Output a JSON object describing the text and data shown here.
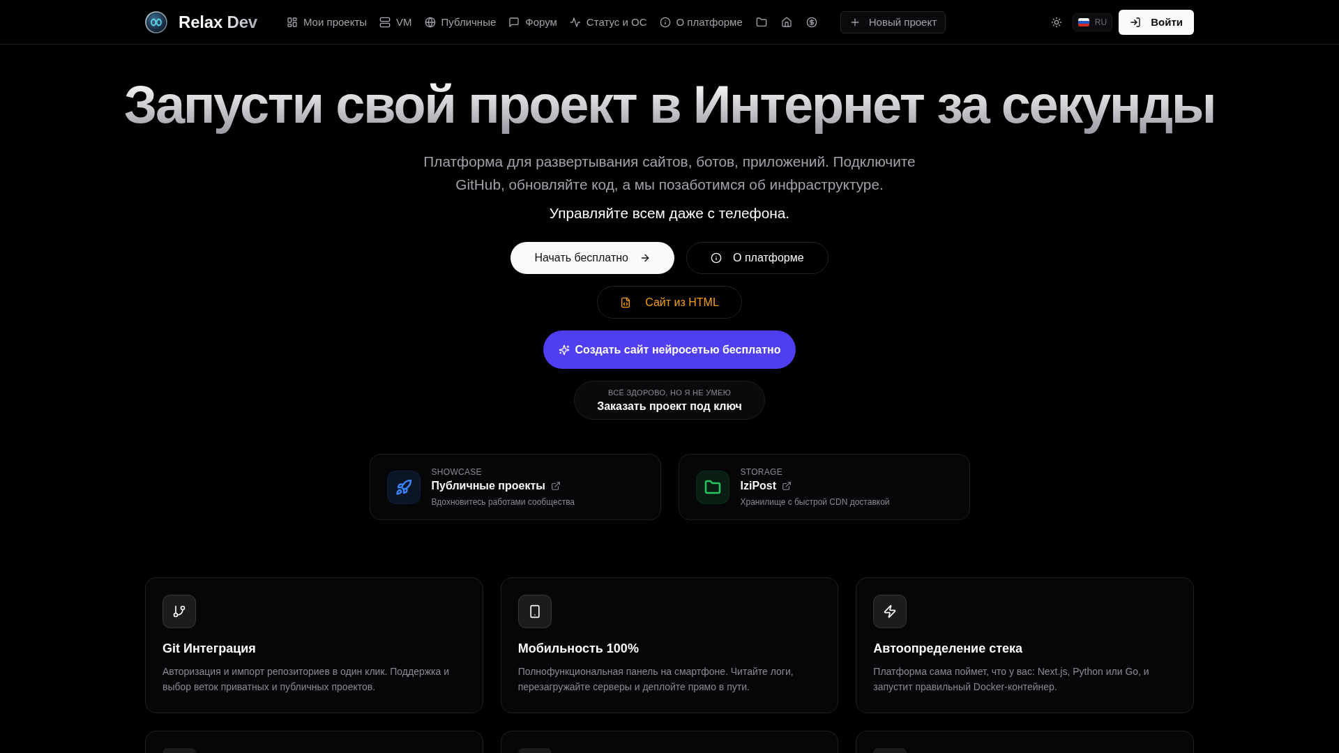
{
  "navbar": {
    "brand": "Relax Dev",
    "links": [
      "Мои проекты",
      "VM",
      "Публичные",
      "Форум",
      "Статус и ОС",
      "О платформе"
    ],
    "new_project_button": "Новый проект",
    "language": "RU",
    "login_button": "Войти"
  },
  "hero": {
    "title": "Запусти свой проект в Интернет за секунды",
    "subtitle": "Платформа для развертывания сайтов, ботов, приложений. Подключите GitHub, обновляйте код, а мы позаботимся об инфраструктуре.",
    "tagline": "Управляйте всем даже с телефона.",
    "primary_button": "Начать бесплатно",
    "secondary_button": "О платформе",
    "html_button": "Сайт из HTML",
    "ai_button": "Создать сайт нейросетью бесплатно",
    "order_button": {
      "eyebrow": "ВСЁ ЗДОРОВО, НО Я НЕ УМЕЮ",
      "label": "Заказать проект под ключ"
    }
  },
  "link_cards": [
    {
      "eyebrow": "SHOWCASE",
      "title": "Публичные проекты",
      "description": "Вдохновитесь работами сообщества",
      "color": "#3b82f6"
    },
    {
      "eyebrow": "STORAGE",
      "title": "IziPost",
      "description": "Хранилище с быстрой CDN доставкой",
      "color": "#22c55e"
    }
  ],
  "features": [
    {
      "kind": "full",
      "title": "Git Интеграция",
      "description": "Авторизация и импорт репозиториев в один клик. Поддержка и выбор веток приватных и публичных проектов."
    },
    {
      "kind": "full",
      "title": "Мобильность 100%",
      "description": "Полнофункциональная панель на смартфоне. Читайте логи, перезагружайте серверы и деплойте прямо в пути."
    },
    {
      "kind": "full",
      "title": "Автоопределение стека",
      "description": "Платформа сама поймет, что у вас: Next.js, Python или Go, и запустит правильный Docker-контейнер."
    },
    {
      "kind": "partial"
    },
    {
      "kind": "partial"
    },
    {
      "kind": "partial"
    }
  ]
}
